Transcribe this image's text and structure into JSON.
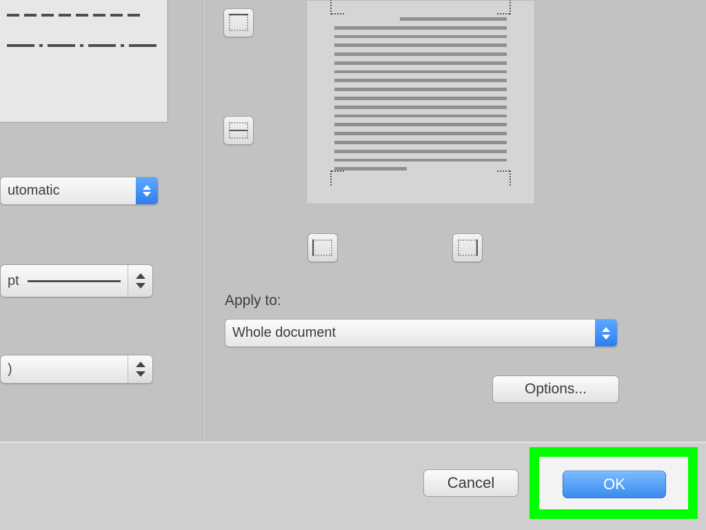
{
  "left": {
    "color_auto": "utomatic",
    "width_pt": "pt",
    "width_value": ")"
  },
  "apply": {
    "label": "Apply to:",
    "value": "Whole document"
  },
  "buttons": {
    "options": "Options...",
    "cancel": "Cancel",
    "ok": "OK"
  }
}
